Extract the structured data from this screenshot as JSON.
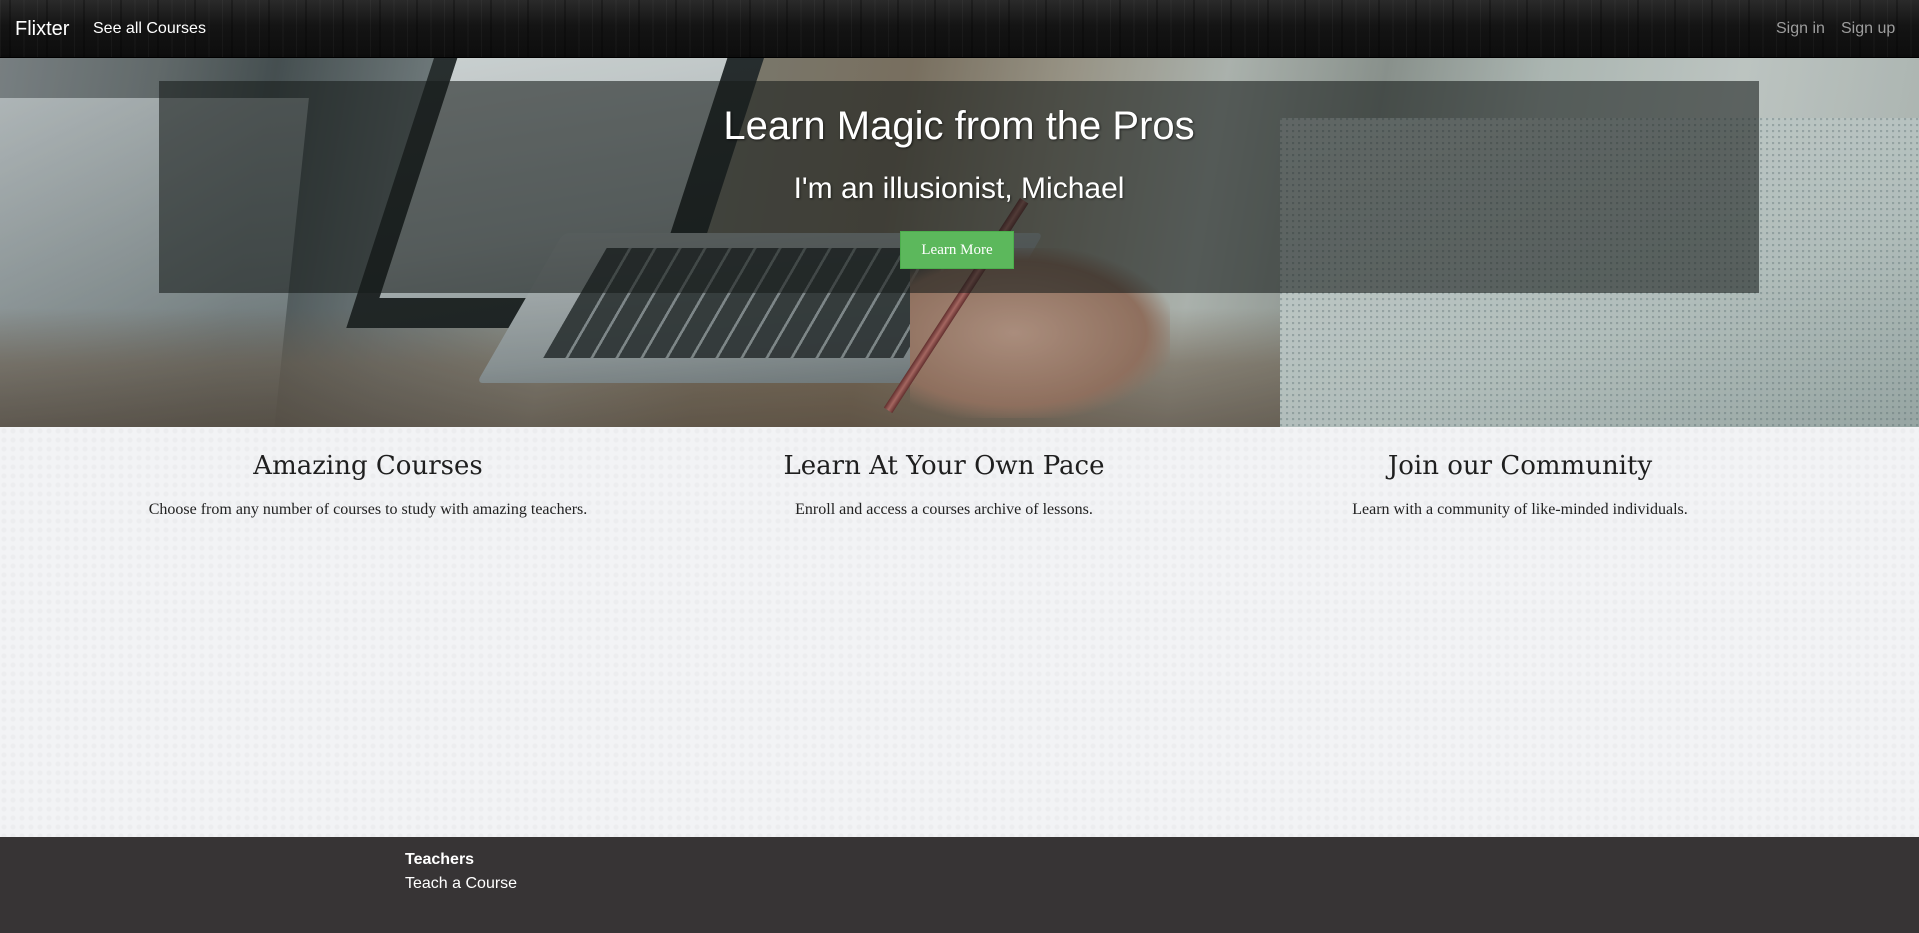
{
  "navbar": {
    "brand": "Flixter",
    "see_all_courses": "See all Courses",
    "sign_in": "Sign in",
    "sign_up": "Sign up"
  },
  "hero": {
    "title": "Learn Magic from the Pros",
    "subtitle": "I'm an illusionist, Michael",
    "button_label": "Learn More",
    "button_color": "#5cb85c"
  },
  "features": [
    {
      "title": "Amazing Courses",
      "description": "Choose from any number of courses to study with amazing teachers."
    },
    {
      "title": "Learn At Your Own Pace",
      "description": "Enroll and access a courses archive of lessons."
    },
    {
      "title": "Join our Community",
      "description": "Learn with a community of like-minded individuals."
    }
  ],
  "footer": {
    "heading": "Teachers",
    "link": "Teach a Course",
    "background": "#373435"
  }
}
